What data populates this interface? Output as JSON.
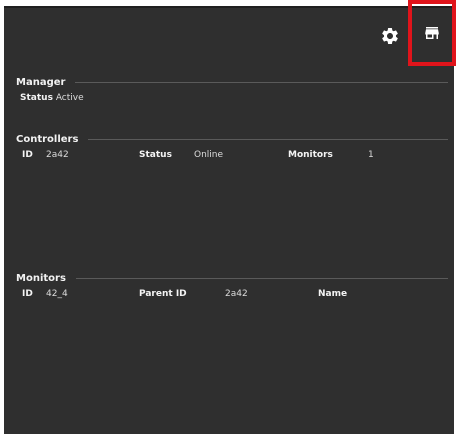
{
  "toolbar": {
    "settings_icon": "gear-icon",
    "store_icon": "storefront-icon",
    "highlight_color": "#e0141b"
  },
  "manager": {
    "title": "Manager",
    "status_label": "Status",
    "status_value": "Active"
  },
  "controllers": {
    "title": "Controllers",
    "id_label": "ID",
    "id_value": "2a42",
    "status_label": "Status",
    "status_value": "Online",
    "monitors_label": "Monitors",
    "monitors_value": "1"
  },
  "monitors": {
    "title": "Monitors",
    "id_label": "ID",
    "id_value": "42_4",
    "parent_label": "Parent ID",
    "parent_value": "2a42",
    "name_label": "Name",
    "name_value": ""
  }
}
